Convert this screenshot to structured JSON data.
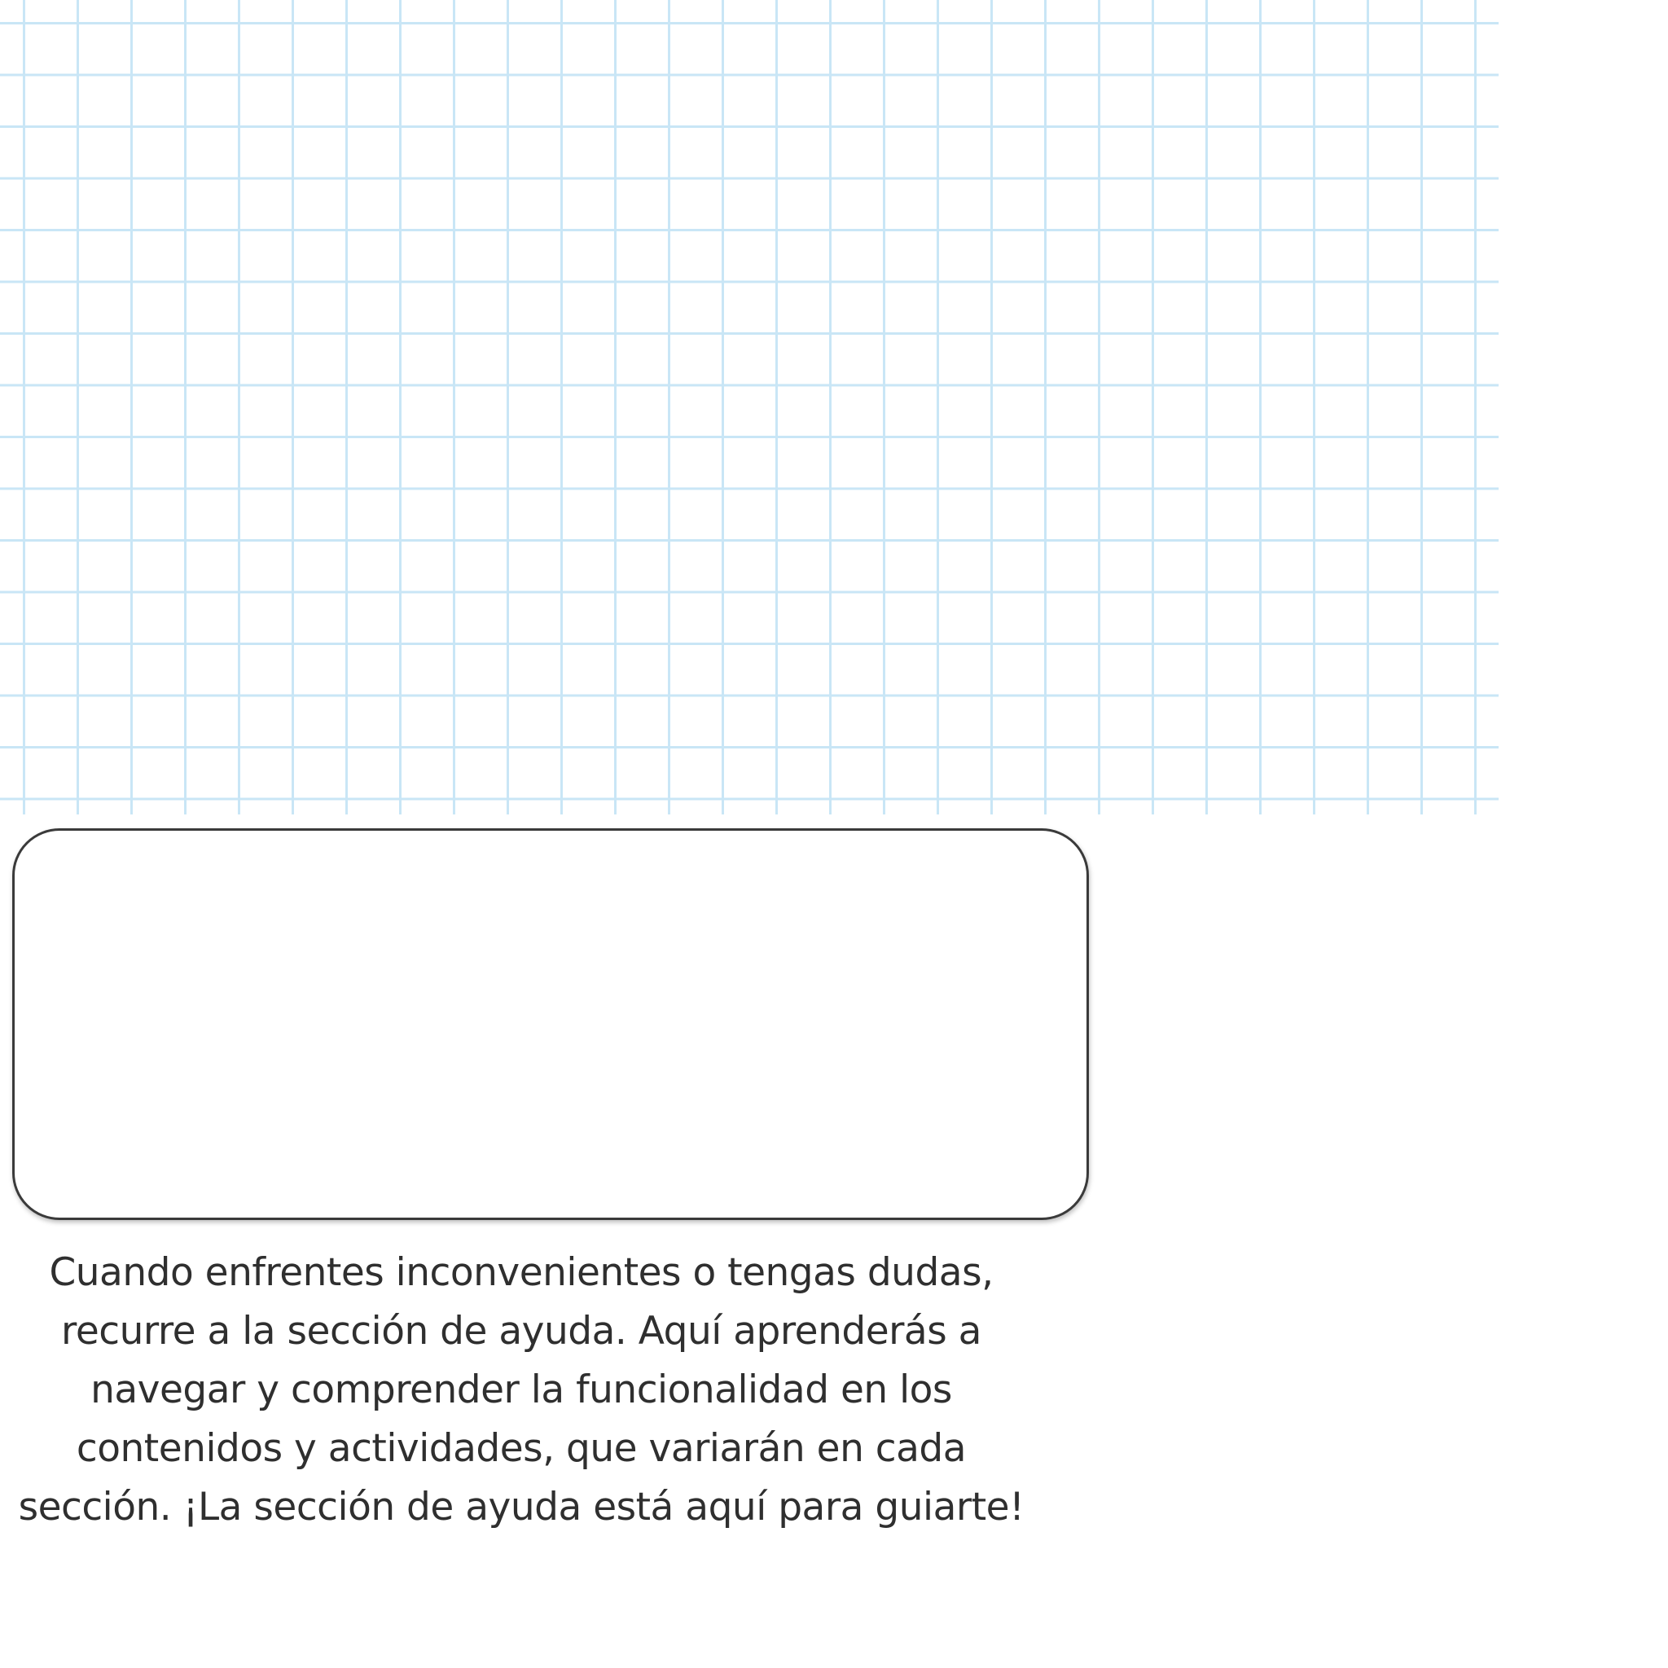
{
  "help_section": {
    "description": "Cuando enfrentes inconvenientes o tengas dudas, recurre a la sección de ayuda. Aquí aprenderás a navegar y comprender la funcionalidad en los contenidos y actividades, que variarán en cada sección. ¡La sección de ayuda está aquí para guiarte!"
  },
  "colors": {
    "grid_line": "#c9e6f6",
    "panel_border": "#3a3a3a",
    "text": "#2f2f2f",
    "background": "#ffffff"
  }
}
